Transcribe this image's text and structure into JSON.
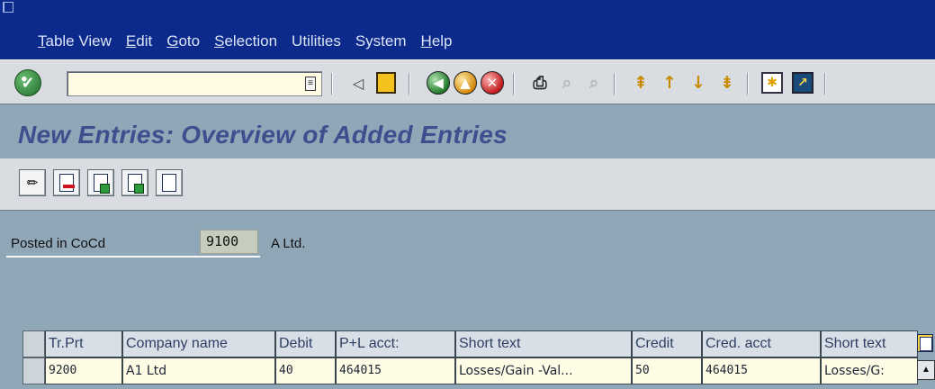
{
  "menu": {
    "items": [
      {
        "hotkey": "T",
        "rest": "able View"
      },
      {
        "hotkey": "E",
        "rest": "dit"
      },
      {
        "hotkey": "G",
        "rest": "oto"
      },
      {
        "hotkey": "S",
        "rest": "election"
      },
      {
        "hotkey": "",
        "rest": "Utilities"
      },
      {
        "hotkey": "",
        "rest": "System"
      },
      {
        "hotkey": "H",
        "rest": "elp"
      }
    ]
  },
  "toolbar": {
    "command_value": "",
    "icons": [
      "enter-icon",
      "command-history-icon",
      "back-arrow-icon",
      "save-icon",
      "back-icon",
      "exit-icon",
      "cancel-icon",
      "print-icon",
      "find-icon",
      "find-next-icon",
      "first-page-icon",
      "previous-page-icon",
      "next-page-icon",
      "last-page-icon",
      "create-session-icon",
      "shortcut-icon"
    ]
  },
  "title": "New Entries: Overview of Added Entries",
  "app_toolbar": {
    "icons": [
      "change-display-icon",
      "delete-entry-icon",
      "select-all-icon",
      "select-block-icon",
      "deselect-all-icon"
    ]
  },
  "header": {
    "cocd_label": "Posted in CoCd",
    "cocd_value": "9100",
    "company_name": "A Ltd."
  },
  "table": {
    "columns": [
      "Tr.Prt",
      "Company name",
      "Debit",
      "P+L acct:",
      "Short text",
      "Credit",
      "Cred. acct",
      "Short text"
    ],
    "rows": [
      [
        "9200",
        "A1 Ltd",
        "40",
        "464015",
        "Losses/Gain -Val...",
        "50",
        "464015",
        "Losses/G:"
      ]
    ]
  },
  "colors": {
    "menubar_bg": "#0c2a8c",
    "workarea_bg": "#8fa7b7",
    "title": "#3d4f8f",
    "input_bg": "#fffce6"
  }
}
